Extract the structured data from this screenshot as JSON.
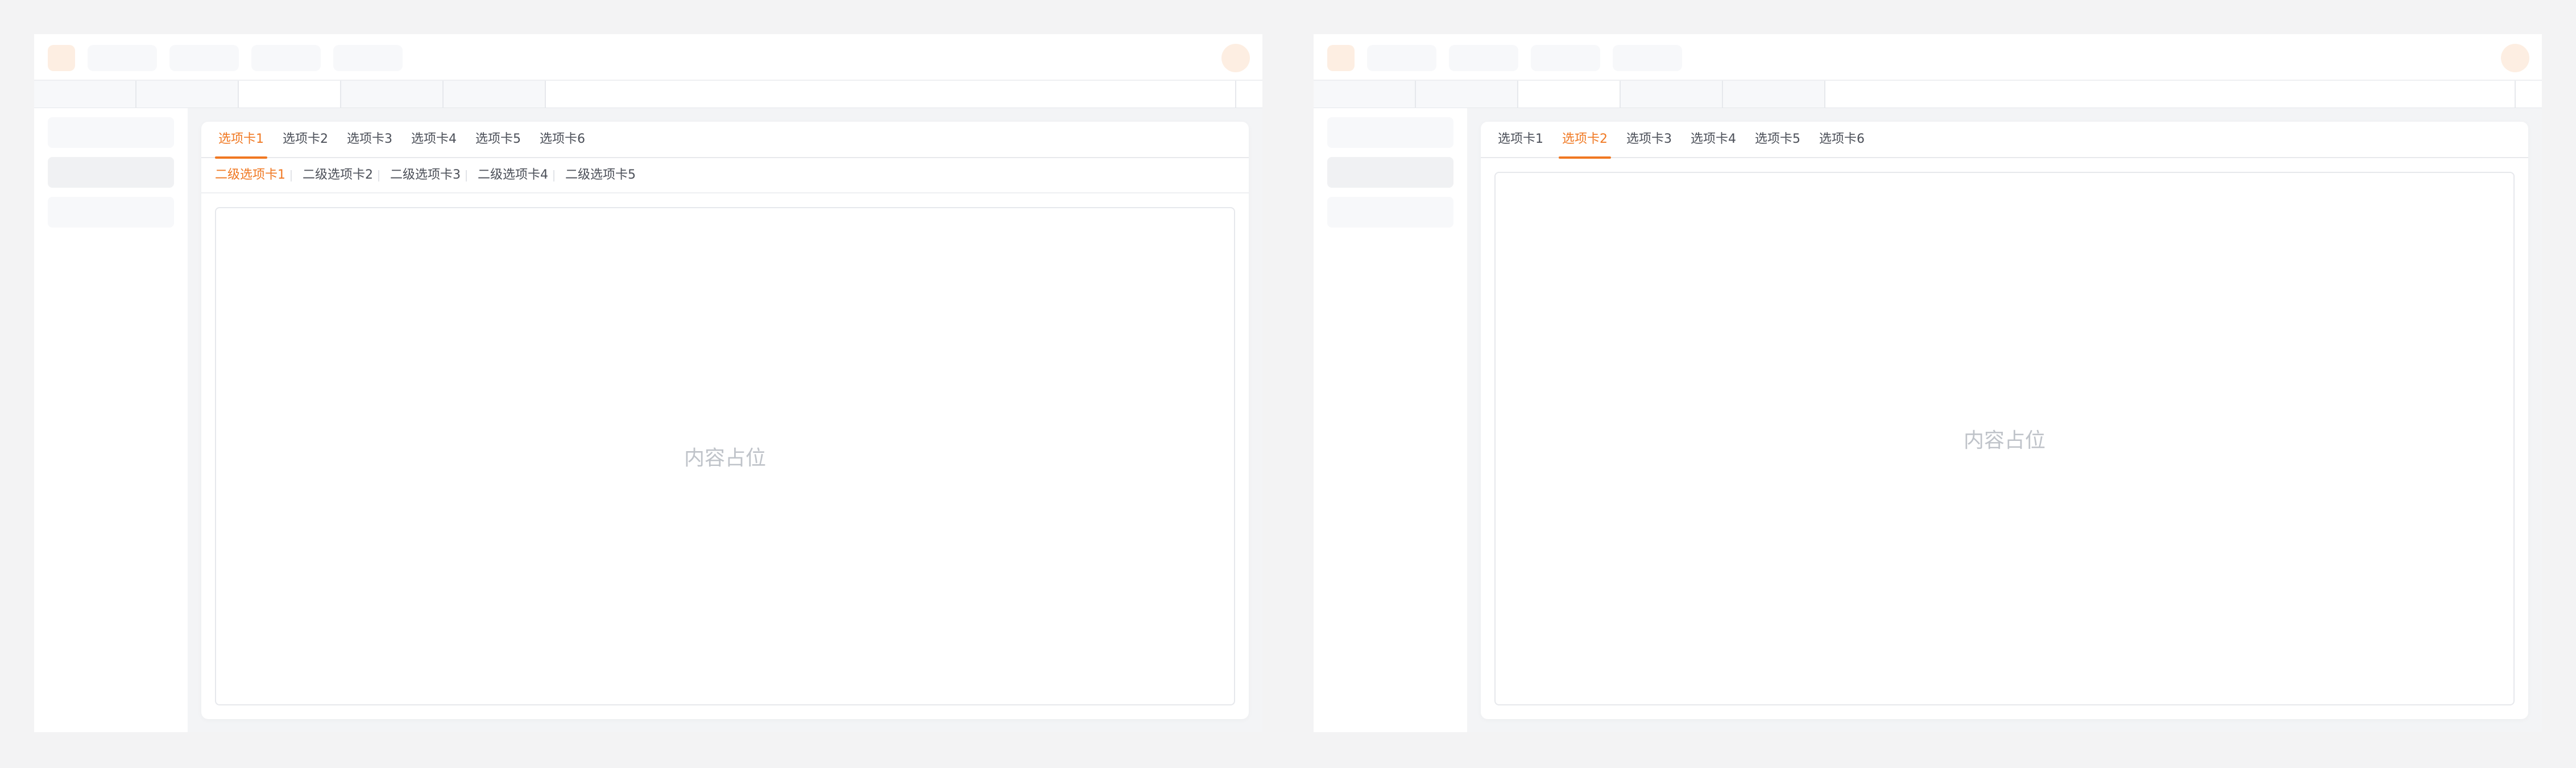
{
  "left_screen": {
    "tabs": [
      {
        "label": "选项卡1",
        "active": true
      },
      {
        "label": "选项卡2",
        "active": false
      },
      {
        "label": "选项卡3",
        "active": false
      },
      {
        "label": "选项卡4",
        "active": false
      },
      {
        "label": "选项卡5",
        "active": false
      },
      {
        "label": "选项卡6",
        "active": false
      }
    ],
    "subtabs": [
      {
        "label": "二级选项卡1",
        "active": true
      },
      {
        "label": "二级选项卡2",
        "active": false
      },
      {
        "label": "二级选项卡3",
        "active": false
      },
      {
        "label": "二级选项卡4",
        "active": false
      },
      {
        "label": "二级选项卡5",
        "active": false
      }
    ],
    "content_placeholder": "内容占位"
  },
  "right_screen": {
    "tabs": [
      {
        "label": "选项卡1",
        "active": false
      },
      {
        "label": "选项卡2",
        "active": true
      },
      {
        "label": "选项卡3",
        "active": false
      },
      {
        "label": "选项卡4",
        "active": false
      },
      {
        "label": "选项卡5",
        "active": false
      },
      {
        "label": "选项卡6",
        "active": false
      }
    ],
    "content_placeholder": "内容占位"
  },
  "colors": {
    "accent": "#f07822",
    "page_background": "#f3f3f4",
    "card_background": "#ffffff",
    "placeholder_text": "#bfc3c9"
  }
}
